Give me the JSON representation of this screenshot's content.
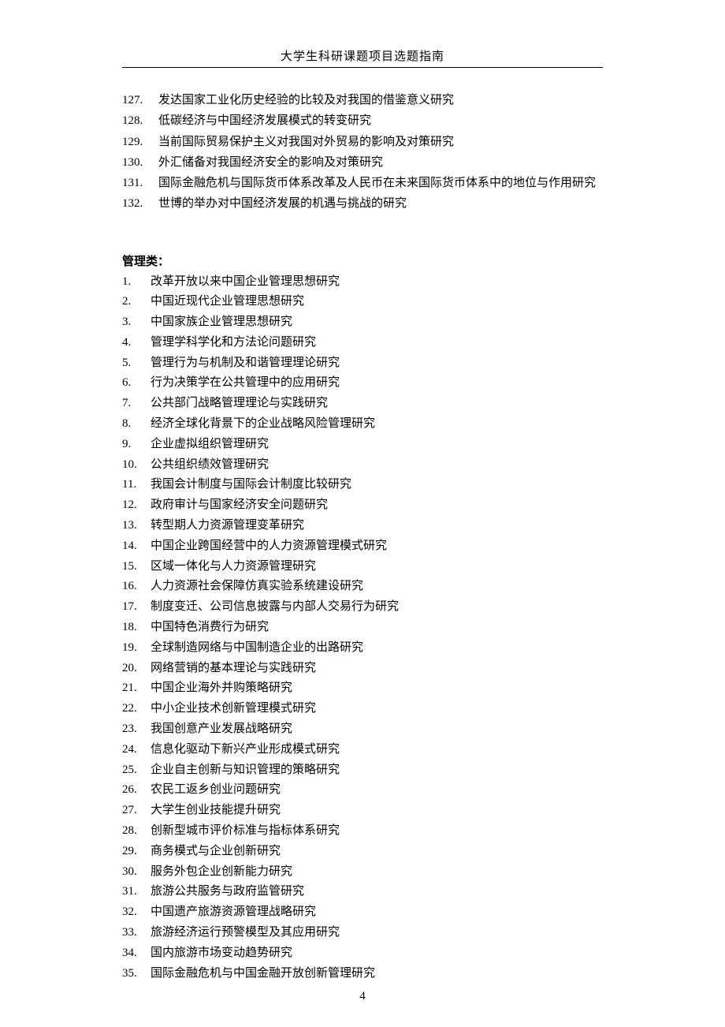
{
  "header": {
    "title": "大学生科研课题项目选题指南"
  },
  "section1": {
    "items": [
      {
        "num": "127.",
        "text": "发达国家工业化历史经验的比较及对我国的借鉴意义研究"
      },
      {
        "num": "128.",
        "text": "低碳经济与中国经济发展模式的转变研究"
      },
      {
        "num": "129.",
        "text": "当前国际贸易保护主义对我国对外贸易的影响及对策研究"
      },
      {
        "num": "130.",
        "text": "外汇储备对我国经济安全的影响及对策研究"
      },
      {
        "num": "131.",
        "text": "国际金融危机与国际货币体系改革及人民币在未来国际货币体系中的地位与作用研究"
      },
      {
        "num": "132.",
        "text": "世博的举办对中国经济发展的机遇与挑战的研究"
      }
    ]
  },
  "section2": {
    "heading": "管理类：",
    "items": [
      {
        "num": "1.",
        "text": "改革开放以来中国企业管理思想研究"
      },
      {
        "num": "2.",
        "text": "中国近现代企业管理思想研究"
      },
      {
        "num": "3.",
        "text": "中国家族企业管理思想研究"
      },
      {
        "num": "4.",
        "text": "管理学科学化和方法论问题研究"
      },
      {
        "num": "5.",
        "text": "管理行为与机制及和谐管理理论研究"
      },
      {
        "num": "6.",
        "text": "行为决策学在公共管理中的应用研究"
      },
      {
        "num": "7.",
        "text": "公共部门战略管理理论与实践研究"
      },
      {
        "num": "8.",
        "text": "经济全球化背景下的企业战略风险管理研究"
      },
      {
        "num": "9.",
        "text": "企业虚拟组织管理研究"
      },
      {
        "num": "10.",
        "text": "公共组织绩效管理研究"
      },
      {
        "num": "11.",
        "text": "我国会计制度与国际会计制度比较研究"
      },
      {
        "num": "12.",
        "text": "政府审计与国家经济安全问题研究"
      },
      {
        "num": "13.",
        "text": "转型期人力资源管理变革研究"
      },
      {
        "num": "14.",
        "text": "中国企业跨国经营中的人力资源管理模式研究"
      },
      {
        "num": "15.",
        "text": "区域一体化与人力资源管理研究"
      },
      {
        "num": "16.",
        "text": "人力资源社会保障仿真实验系统建设研究"
      },
      {
        "num": "17.",
        "text": "制度变迁、公司信息披露与内部人交易行为研究"
      },
      {
        "num": "18.",
        "text": "中国特色消费行为研究"
      },
      {
        "num": "19.",
        "text": "全球制造网络与中国制造企业的出路研究"
      },
      {
        "num": "20.",
        "text": "网络营销的基本理论与实践研究"
      },
      {
        "num": "21.",
        "text": "中国企业海外并购策略研究"
      },
      {
        "num": "22.",
        "text": "中小企业技术创新管理模式研究"
      },
      {
        "num": "23.",
        "text": "我国创意产业发展战略研究"
      },
      {
        "num": "24.",
        "text": "信息化驱动下新兴产业形成模式研究"
      },
      {
        "num": "25.",
        "text": "企业自主创新与知识管理的策略研究"
      },
      {
        "num": "26.",
        "text": "农民工返乡创业问题研究"
      },
      {
        "num": "27.",
        "text": "大学生创业技能提升研究"
      },
      {
        "num": "28.",
        "text": "创新型城市评价标准与指标体系研究"
      },
      {
        "num": "29.",
        "text": "商务模式与企业创新研究"
      },
      {
        "num": "30.",
        "text": "服务外包企业创新能力研究"
      },
      {
        "num": "31.",
        "text": "旅游公共服务与政府监管研究"
      },
      {
        "num": "32.",
        "text": "中国遗产旅游资源管理战略研究"
      },
      {
        "num": "33.",
        "text": "旅游经济运行预警模型及其应用研究"
      },
      {
        "num": "34.",
        "text": "国内旅游市场变动趋势研究"
      },
      {
        "num": "35.",
        "text": "国际金融危机与中国金融开放创新管理研究"
      }
    ]
  },
  "footer": {
    "page_number": "4"
  }
}
